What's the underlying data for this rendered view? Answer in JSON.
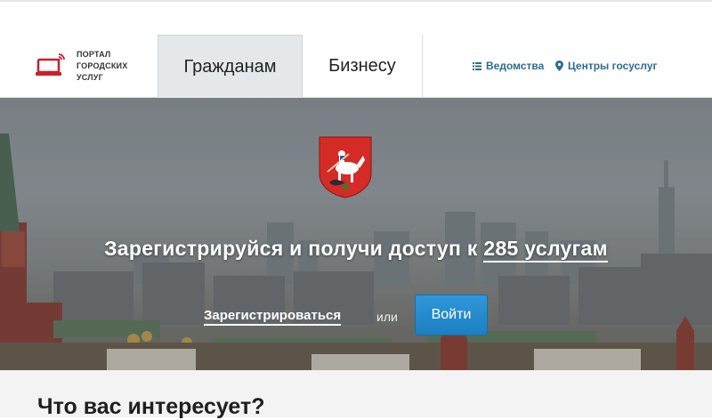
{
  "header": {
    "logo": {
      "line1": "ПОРТАЛ",
      "line2": "ГОРОДСКИХ",
      "line3": "УСЛУГ",
      "icon": "laptop-signal-icon",
      "icon_color": "#c8202d"
    },
    "tabs": [
      {
        "label": "Гражданам",
        "active": true
      },
      {
        "label": "Бизнесу",
        "active": false
      }
    ],
    "links": {
      "departments": "Ведомства",
      "centers": "Центры госуслуг"
    },
    "link_color": "#2d6d8f"
  },
  "hero": {
    "emblem": "moscow-coat-of-arms-icon",
    "headline_prefix": "Зарегистрируйся и получи доступ к ",
    "headline_count": "285 услугам",
    "register_label": "Зарегистрироваться",
    "or_text": "или",
    "login_label": "Войти",
    "login_color": "#2589cc"
  },
  "section": {
    "title": "Что вас интересует?"
  }
}
